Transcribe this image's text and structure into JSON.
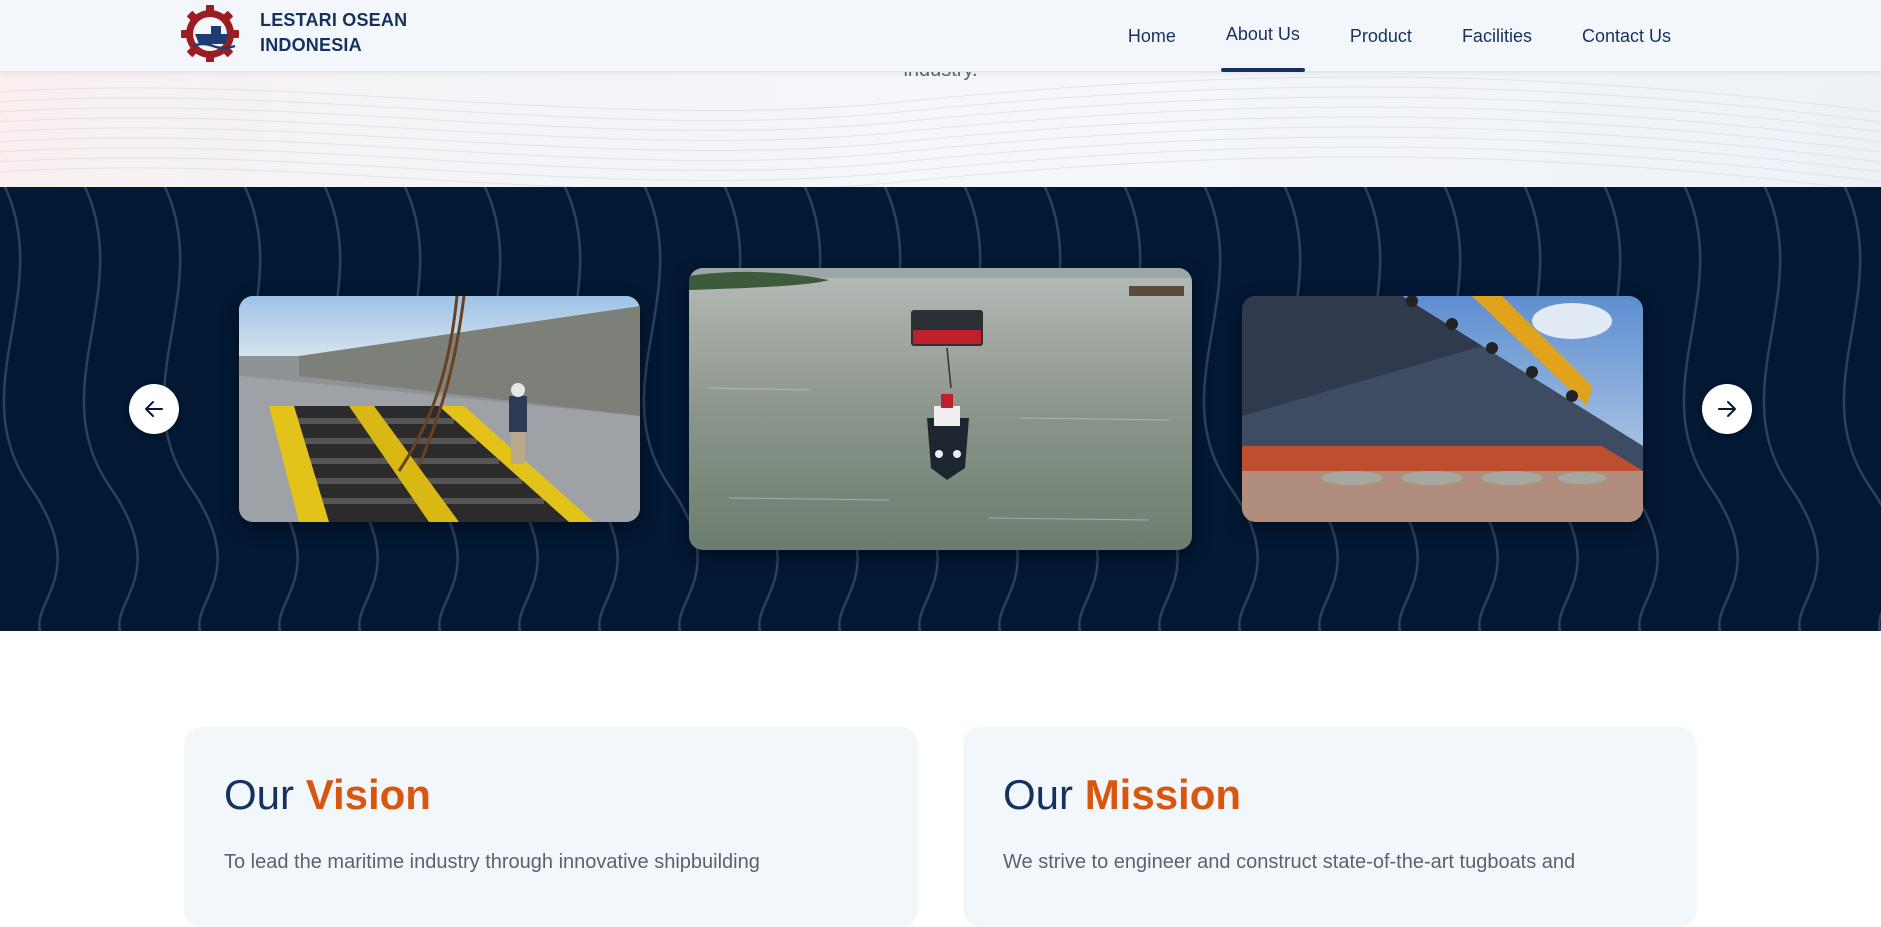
{
  "header": {
    "brand_line1": "LESTARI OSEAN",
    "brand_line2": "INDONESIA",
    "logo_icon": "gear-ship-logo",
    "nav": [
      {
        "label": "Home",
        "active": false
      },
      {
        "label": "About Us",
        "active": true
      },
      {
        "label": "Product",
        "active": false
      },
      {
        "label": "Facilities",
        "active": false
      },
      {
        "label": "Contact Us",
        "active": false
      }
    ]
  },
  "hero": {
    "text_fragment": "industry."
  },
  "gallery": {
    "prev_icon": "arrow-left-icon",
    "next_icon": "arrow-right-icon",
    "slides": [
      {
        "subject": "worker on barge deck with ramp and chains"
      },
      {
        "subject": "tugboat towing barge on open water"
      },
      {
        "subject": "barge hull on launching airbags in shipyard"
      }
    ]
  },
  "vision": {
    "title_prefix": "Our",
    "title_accent": "Vision",
    "text": "To lead the maritime industry through innovative shipbuilding"
  },
  "mission": {
    "title_prefix": "Our",
    "title_accent": "Mission",
    "text": "We strive to engineer and construct state-of-the-art tugboats and"
  },
  "colors": {
    "navy": "#15325f",
    "dark_bg": "#021833",
    "accent_orange": "#d9560f",
    "header_bg": "#f3f7fc",
    "card_bg": "#f2f7fc"
  }
}
